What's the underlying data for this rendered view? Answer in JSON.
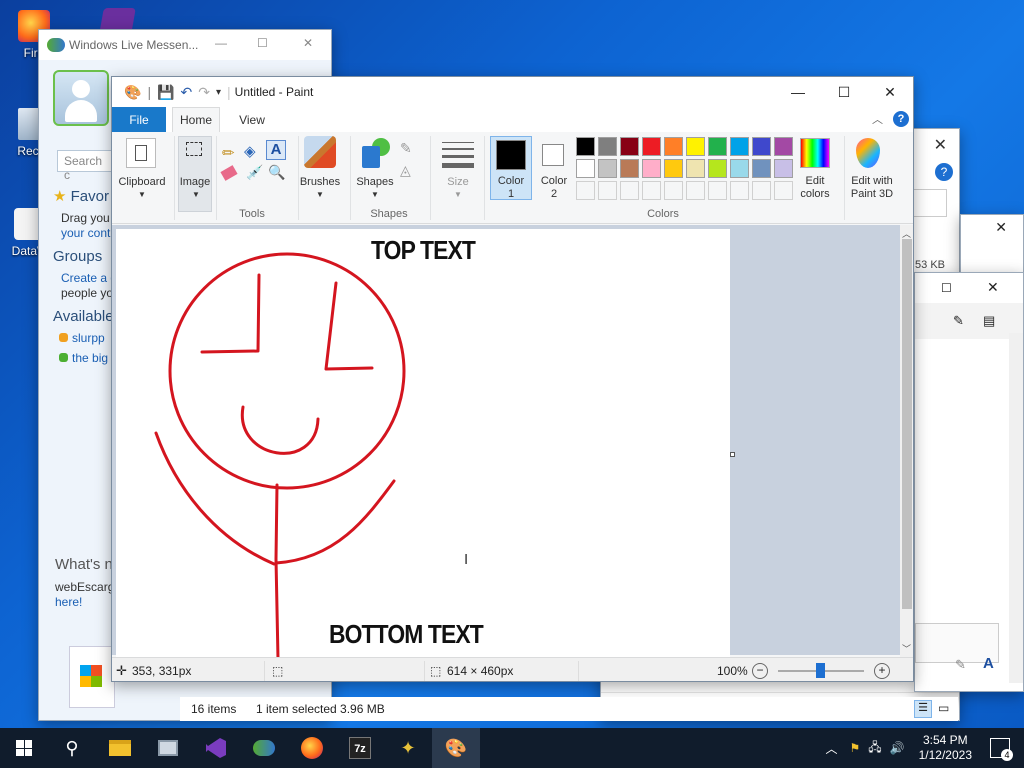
{
  "desktop": {
    "icons": [
      {
        "label": "Fire",
        "icon": "firefox-icon"
      },
      {
        "label": "Recyc",
        "icon": "recycle-bin-icon"
      },
      {
        "label": "DataW",
        "icon": "datawarehouse-icon"
      }
    ]
  },
  "messenger": {
    "title": "Windows Live Messen...",
    "search_placeholder": "Search c",
    "favorites": "Favor",
    "drag_text": "Drag you",
    "drag_link": "your cont",
    "groups": "Groups",
    "create_link": "Create a g",
    "people_text": "people yo",
    "available": "Available",
    "contacts": [
      {
        "name": "slurpp",
        "status": "away"
      },
      {
        "name": "the big",
        "status": "online"
      }
    ],
    "whats_new": "What's n",
    "promo_text": "webEscarg",
    "promo_link": "here!"
  },
  "explorer": {
    "size_text": "53 KB",
    "status_items": "16 items",
    "status_selected": "1 item selected  3.96 MB"
  },
  "paint": {
    "title": "Untitled - Paint",
    "tabs": {
      "file": "File",
      "home": "Home",
      "view": "View"
    },
    "ribbon": {
      "clipboard": "Clipboard",
      "image": "Image",
      "tools_group": "Tools",
      "brushes": "Brushes",
      "shapes": "Shapes",
      "shapes_group": "Shapes",
      "size": "Size",
      "color1_line1": "Color",
      "color1_line2": "1",
      "color2_line1": "Color",
      "color2_line2": "2",
      "colors_group": "Colors",
      "edit_colors_line1": "Edit",
      "edit_colors_line2": "colors",
      "paint3d_line1": "Edit with",
      "paint3d_line2": "Paint 3D"
    },
    "palette_row1": [
      "#000000",
      "#7f7f7f",
      "#880015",
      "#ed1c24",
      "#ff7f27",
      "#fff200",
      "#22b14c",
      "#00a2e8",
      "#3f48cc",
      "#a349a4"
    ],
    "palette_row2": [
      "#ffffff",
      "#c3c3c3",
      "#b97a57",
      "#ffaec9",
      "#ffc90e",
      "#efe4b0",
      "#b5e61d",
      "#99d9ea",
      "#7092be",
      "#c8bfe7"
    ],
    "color1": "#000000",
    "color2": "#ffffff",
    "canvas": {
      "top_text": "TOP TEXT",
      "bottom_text": "BOTTOM TEXT",
      "stroke_color": "#d4151f"
    },
    "status": {
      "cursor_pos": "353, 331px",
      "canvas_size": "614 × 460px",
      "zoom": "100%"
    }
  },
  "taskbar": {
    "apps": [
      "windows-start-icon",
      "search-icon",
      "file-explorer-icon",
      "remote-desktop-icon",
      "visual-studio-icon",
      "messenger-icon",
      "firefox-icon",
      "7zip-icon",
      "wand-icon",
      "paint-icon"
    ],
    "time": "3:54 PM",
    "date": "1/12/2023",
    "notification_count": "4"
  }
}
